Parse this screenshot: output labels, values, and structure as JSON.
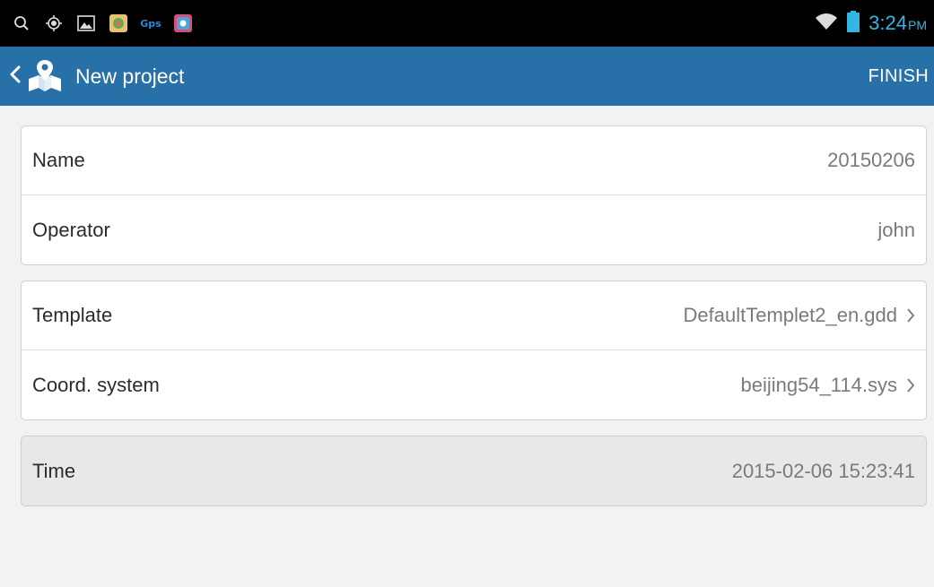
{
  "status_bar": {
    "icons": [
      "search-icon",
      "location-target-icon",
      "image-icon",
      "app-color-icon",
      "gps-icon",
      "app-camera-icon"
    ],
    "gps_text": "Gps",
    "time": "3:24",
    "ampm": "PM"
  },
  "app_bar": {
    "title": "New project",
    "finish_label": "FINISH",
    "icon": "map-pin-icon"
  },
  "groups": [
    {
      "rows": [
        {
          "label": "Name",
          "value": "20150206"
        },
        {
          "label": "Operator",
          "value": "john"
        }
      ]
    },
    {
      "rows": [
        {
          "label": "Template",
          "value": "DefaultTemplet2_en.gdd"
        },
        {
          "label": "Coord. system",
          "value": "beijing54_114.sys"
        }
      ]
    },
    {
      "rows": [
        {
          "label": "Time",
          "value": "2015-02-06 15:23:41"
        }
      ]
    }
  ],
  "colors": {
    "app_bar": "#2770a8",
    "clock": "#33b5e5",
    "background": "#f2f2f2"
  }
}
